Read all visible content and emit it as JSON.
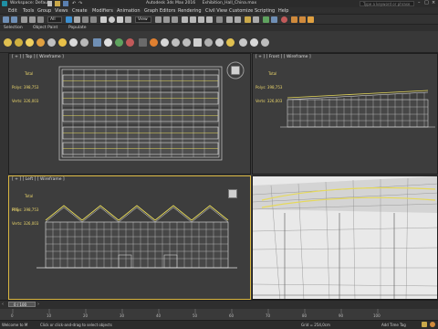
{
  "window": {
    "workspace_label": "Workspace: Default",
    "title": "Autodesk 3ds Max 2016",
    "file_name": "Exhibition_Hall_China.max",
    "search_placeholder": "Type a keyword or phrase"
  },
  "menu": [
    "Edit",
    "Tools",
    "Group",
    "Views",
    "Create",
    "Modifiers",
    "Animation",
    "Graph Editors",
    "Rendering",
    "Civil View",
    "Customize",
    "Scripting",
    "Help"
  ],
  "toolbar": {
    "selection_filter": "All",
    "view_select": "View"
  },
  "ribbon_tabs": [
    "Selection",
    "Object Paint",
    "Populate"
  ],
  "viewports": {
    "top": {
      "label": "[ + ] [ Top ] [ Wireframe ]",
      "stats_total": "Total",
      "stats_polys": "Polys: 398,753",
      "stats_verts": "Verts: 326,003"
    },
    "front": {
      "label": "[ + ] [ Front ] [ Wireframe ]",
      "stats_total": "Total",
      "stats_polys": "Polys: 398,753",
      "stats_verts": "Verts: 326,003"
    },
    "left": {
      "label": "[ + ] [ Left ] [ Wireframe ]",
      "stats_total": "Total",
      "stats_polys": "Polys: 398,753",
      "stats_verts": "Verts: 326,003",
      "fps": "FPS:"
    },
    "perspective": {
      "label": "[ + ] [ Perspective ] [ Realistic ]"
    }
  },
  "timeline": {
    "frame_display": "0 / 100",
    "ticks": [
      "0",
      "10",
      "20",
      "30",
      "40",
      "50",
      "60",
      "70",
      "80",
      "90",
      "100"
    ]
  },
  "status": {
    "script_label": "Welcome to M",
    "message": "Click or click-and-drag to select objects",
    "grid": "Grid = 254,0cm",
    "add_time_tag": "Add Time Tag",
    "auto_key": "Auto Key",
    "set_key": "Set Key",
    "selected": "Selected"
  },
  "colors": {
    "wire_white": "#e8e8e8",
    "wire_yellow": "#e6d95a",
    "active_border": "#d9b640",
    "viewport_bg": "#3d3d3d"
  }
}
